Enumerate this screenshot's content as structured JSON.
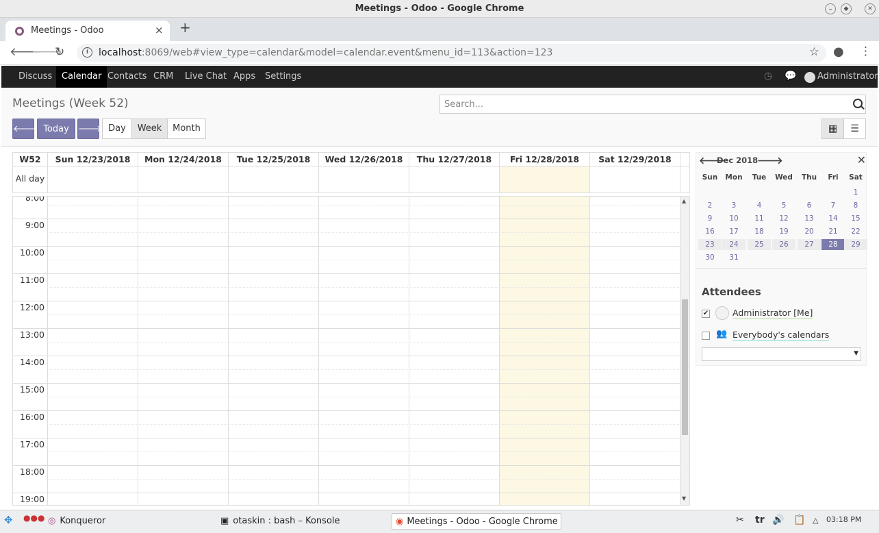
{
  "browser": {
    "window_title": "Meetings - Odoo - Google Chrome",
    "tab_title": "Meetings - Odoo",
    "url_host": "localhost",
    "url_rest": ":8069/web#view_type=calendar&model=calendar.event&menu_id=113&action=123",
    "new_tab_label": "+",
    "close_tab_label": "×"
  },
  "odoo_nav": {
    "items": [
      "Discuss",
      "Calendar",
      "Contacts",
      "CRM",
      "Live Chat",
      "Apps",
      "Settings"
    ],
    "active": "Calendar",
    "user": "Administrator"
  },
  "control_panel": {
    "title": "Meetings (Week 52)",
    "search_placeholder": "Search...",
    "prev_label": "🡐",
    "today_label": "Today",
    "next_label": "🡒",
    "scale_buttons": [
      "Day",
      "Week",
      "Month"
    ],
    "active_scale": "Week"
  },
  "calendar": {
    "week_label": "W52",
    "all_day_label": "All day",
    "days": [
      "Sun 12/23/2018",
      "Mon 12/24/2018",
      "Tue 12/25/2018",
      "Wed 12/26/2018",
      "Thu 12/27/2018",
      "Fri 12/28/2018",
      "Sat 12/29/2018"
    ],
    "today_index": 5,
    "hours": [
      "8:00",
      "9:00",
      "10:00",
      "11:00",
      "12:00",
      "13:00",
      "14:00",
      "15:00",
      "16:00",
      "17:00",
      "18:00",
      "19:00"
    ]
  },
  "mini_calendar": {
    "month_label": "Dec 2018",
    "prev_icon": "🡐",
    "next_icon": "🡒",
    "close_icon": "✕",
    "weekdays": [
      "Sun",
      "Mon",
      "Tue",
      "Wed",
      "Thu",
      "Fri",
      "Sat"
    ],
    "weeks": [
      [
        "",
        "",
        "",
        "",
        "",
        "",
        "1"
      ],
      [
        "2",
        "3",
        "4",
        "5",
        "6",
        "7",
        "8"
      ],
      [
        "9",
        "10",
        "11",
        "12",
        "13",
        "14",
        "15"
      ],
      [
        "16",
        "17",
        "18",
        "19",
        "20",
        "21",
        "22"
      ],
      [
        "23",
        "24",
        "25",
        "26",
        "27",
        "28",
        "29"
      ],
      [
        "30",
        "31",
        "",
        "",
        "",
        "",
        ""
      ]
    ],
    "selected_day": "28"
  },
  "attendees": {
    "title": "Attendees",
    "items": [
      {
        "name": "Administrator [Me]",
        "checked": true,
        "underline": "#d4ecc8"
      },
      {
        "name": "Everybody's calendars",
        "checked": false,
        "underline": "#bfe7e3"
      }
    ]
  },
  "taskbar": {
    "items": [
      "Konqueror",
      "otaskin : bash – Konsole",
      "Meetings - Odoo - Google Chrome"
    ],
    "active": "Meetings - Odoo - Google Chrome",
    "layout": "tr",
    "time": "03:18 PM"
  },
  "colors": {
    "primary": "#7c7bad",
    "today_bg": "#fcf8e3",
    "nav_bg": "#222222"
  }
}
